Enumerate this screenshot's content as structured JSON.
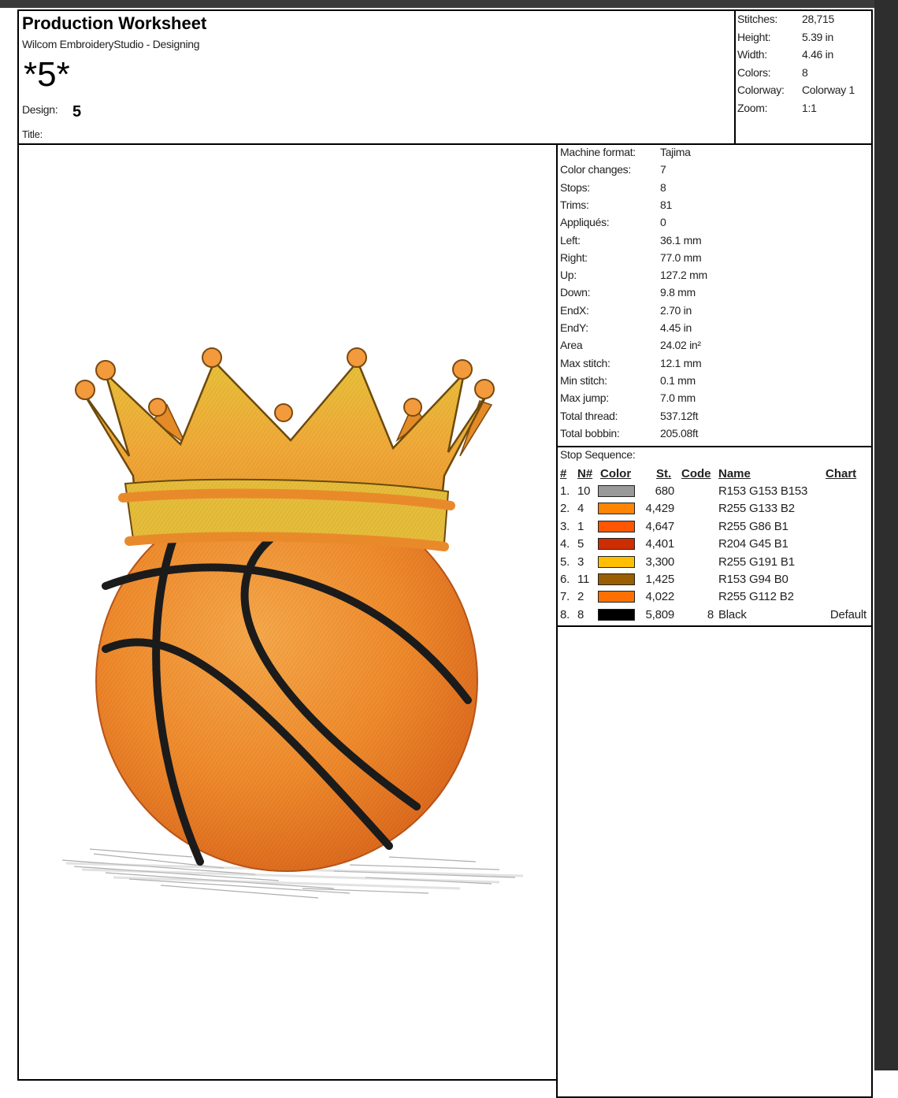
{
  "header": {
    "sheet_title": "Production Worksheet",
    "software": "Wilcom EmbroideryStudio - Designing",
    "design_big": "*5*",
    "design_label": "Design:",
    "design_value": "5",
    "title_label": "Title:"
  },
  "stats": [
    {
      "label": "Stitches:",
      "value": "28,715"
    },
    {
      "label": "Height:",
      "value": "5.39 in"
    },
    {
      "label": "Width:",
      "value": "4.46 in"
    },
    {
      "label": "Colors:",
      "value": "8"
    },
    {
      "label": "Colorway:",
      "value": "Colorway 1"
    },
    {
      "label": "Zoom:",
      "value": "1:1"
    }
  ],
  "machine": [
    {
      "label": "Machine format:",
      "value": "Tajima"
    },
    {
      "label": "Color changes:",
      "value": "7"
    },
    {
      "label": "Stops:",
      "value": "8"
    },
    {
      "label": "Trims:",
      "value": "81"
    },
    {
      "label": "Appliqués:",
      "value": "0"
    },
    {
      "label": "Left:",
      "value": "36.1 mm"
    },
    {
      "label": "Right:",
      "value": "77.0 mm"
    },
    {
      "label": "Up:",
      "value": "127.2 mm"
    },
    {
      "label": "Down:",
      "value": "9.8 mm"
    },
    {
      "label": "EndX:",
      "value": "2.70 in"
    },
    {
      "label": "EndY:",
      "value": "4.45 in"
    },
    {
      "label": "Area",
      "value": "24.02 in²"
    },
    {
      "label": "Max stitch:",
      "value": "12.1 mm"
    },
    {
      "label": "Min stitch:",
      "value": "0.1 mm"
    },
    {
      "label": "Max jump:",
      "value": "7.0 mm"
    },
    {
      "label": "Total thread:",
      "value": "537.12ft"
    },
    {
      "label": "Total bobbin:",
      "value": "205.08ft"
    }
  ],
  "stop_sequence": {
    "title": "Stop Sequence:",
    "headers": {
      "num": "#",
      "n": "N#",
      "color": "Color",
      "st": "St.",
      "code": "Code",
      "name": "Name",
      "chart": "Chart"
    },
    "rows": [
      {
        "num": "1.",
        "n": "10",
        "color": "#999999",
        "st": "680",
        "code": "",
        "name": "R153 G153 B153",
        "chart": ""
      },
      {
        "num": "2.",
        "n": "4",
        "color": "#ff8502",
        "st": "4,429",
        "code": "",
        "name": "R255 G133 B2",
        "chart": ""
      },
      {
        "num": "3.",
        "n": "1",
        "color": "#ff5601",
        "st": "4,647",
        "code": "",
        "name": "R255 G86 B1",
        "chart": ""
      },
      {
        "num": "4.",
        "n": "5",
        "color": "#cc2d01",
        "st": "4,401",
        "code": "",
        "name": "R204 G45 B1",
        "chart": ""
      },
      {
        "num": "5.",
        "n": "3",
        "color": "#ffbf01",
        "st": "3,300",
        "code": "",
        "name": "R255 G191 B1",
        "chart": ""
      },
      {
        "num": "6.",
        "n": "11",
        "color": "#995e00",
        "st": "1,425",
        "code": "",
        "name": "R153 G94 B0",
        "chart": ""
      },
      {
        "num": "7.",
        "n": "2",
        "color": "#ff7002",
        "st": "4,022",
        "code": "",
        "name": "R255 G112 B2",
        "chart": ""
      },
      {
        "num": "8.",
        "n": "8",
        "color": "#000000",
        "st": "5,809",
        "code": "8",
        "name": "Black",
        "chart": "Default"
      }
    ]
  }
}
